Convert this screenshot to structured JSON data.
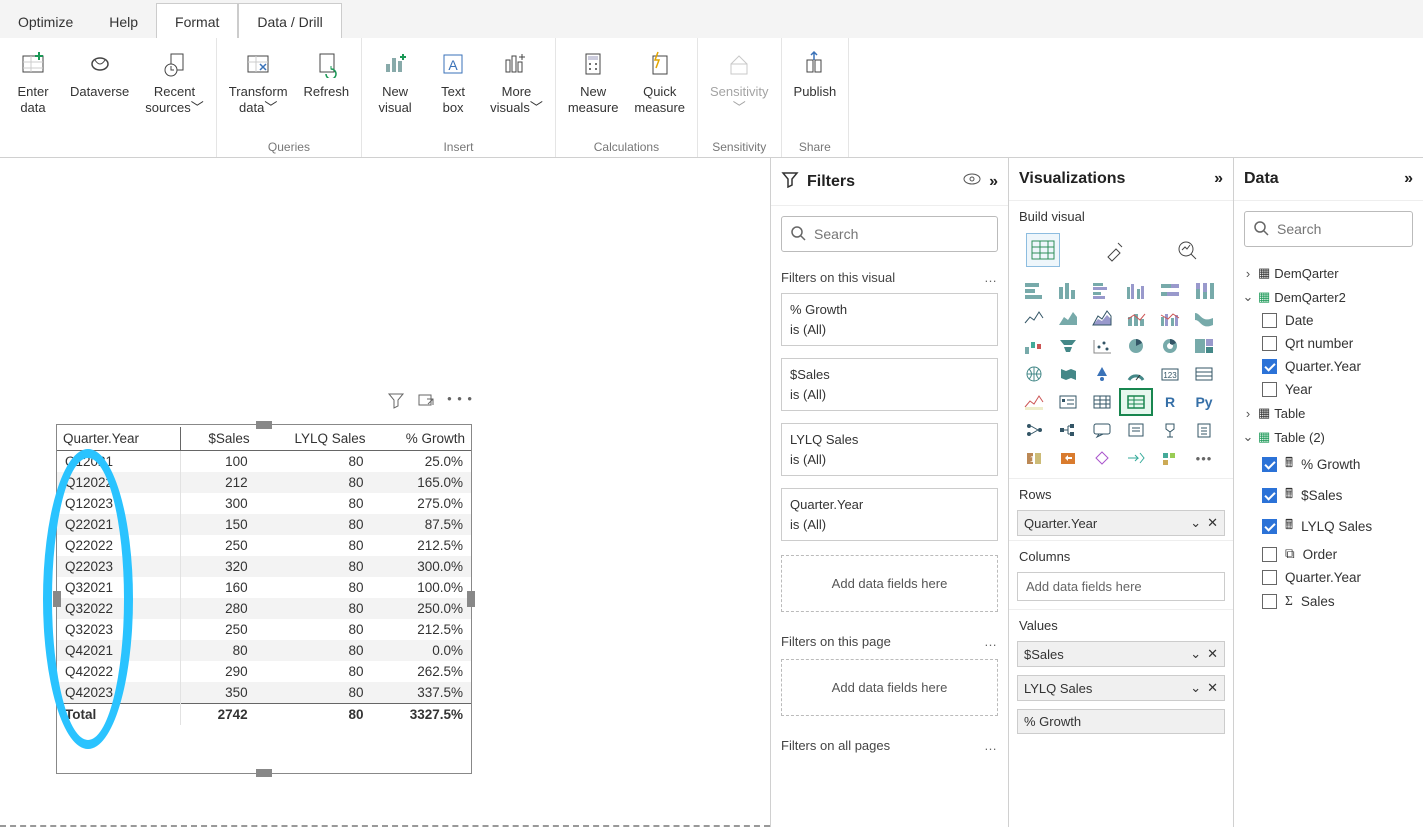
{
  "ribbon_tabs": {
    "t0": "Optimize",
    "t1": "Help",
    "t2": "Format",
    "t3": "Data / Drill"
  },
  "ribbon": {
    "data_group": "",
    "enter_data": "Enter\ndata",
    "dataverse": "Dataverse",
    "recent_sources": "Recent\nsources",
    "queries_group": "Queries",
    "transform_data": "Transform\ndata",
    "refresh": "Refresh",
    "insert_group": "Insert",
    "new_visual": "New\nvisual",
    "text_box": "Text\nbox",
    "more_visuals": "More\nvisuals",
    "calc_group": "Calculations",
    "new_measure": "New\nmeasure",
    "quick_measure": "Quick\nmeasure",
    "sens_group": "Sensitivity",
    "sensitivity": "Sensitivity",
    "share_group": "Share",
    "publish": "Publish"
  },
  "filters": {
    "title": "Filters",
    "search_placeholder": "Search",
    "on_visual": "Filters on this visual",
    "on_page": "Filters on this page",
    "on_all": "Filters on all pages",
    "add_fields": "Add data fields here",
    "is_all": "is (All)",
    "f1": "% Growth",
    "f2": "$Sales",
    "f3": "LYLQ Sales",
    "f4": "Quarter.Year"
  },
  "viz": {
    "title": "Visualizations",
    "build": "Build visual",
    "rows": "Rows",
    "columns": "Columns",
    "values": "Values",
    "chip_rows": "Quarter.Year",
    "chip_v1": "$Sales",
    "chip_v2": "LYLQ Sales",
    "chip_v3": "% Growth",
    "add_fields": "Add data fields here"
  },
  "datapane": {
    "title": "Data",
    "search_placeholder": "Search",
    "g1": "DemQarter",
    "g2": "DemQarter2",
    "g2_f1": "Date",
    "g2_f2": "Qrt number",
    "g2_f3": "Quarter.Year",
    "g2_f4": "Year",
    "g3": "Table",
    "g4": "Table (2)",
    "g4_f1": "% Growth",
    "g4_f2": "$Sales",
    "g4_f3": "LYLQ Sales",
    "g4_f4": "Order",
    "g4_f5": "Quarter.Year",
    "g4_f6": "Sales"
  },
  "table": {
    "headers": {
      "c0": "Quarter.Year",
      "c1": "$Sales",
      "c2": "LYLQ Sales",
      "c3": "% Growth"
    },
    "rows": [
      {
        "c0": "Q12021",
        "c1": "100",
        "c2": "80",
        "c3": "25.0%"
      },
      {
        "c0": "Q12022",
        "c1": "212",
        "c2": "80",
        "c3": "165.0%"
      },
      {
        "c0": "Q12023",
        "c1": "300",
        "c2": "80",
        "c3": "275.0%"
      },
      {
        "c0": "Q22021",
        "c1": "150",
        "c2": "80",
        "c3": "87.5%"
      },
      {
        "c0": "Q22022",
        "c1": "250",
        "c2": "80",
        "c3": "212.5%"
      },
      {
        "c0": "Q22023",
        "c1": "320",
        "c2": "80",
        "c3": "300.0%"
      },
      {
        "c0": "Q32021",
        "c1": "160",
        "c2": "80",
        "c3": "100.0%"
      },
      {
        "c0": "Q32022",
        "c1": "280",
        "c2": "80",
        "c3": "250.0%"
      },
      {
        "c0": "Q32023",
        "c1": "250",
        "c2": "80",
        "c3": "212.5%"
      },
      {
        "c0": "Q42021",
        "c1": "80",
        "c2": "80",
        "c3": "0.0%"
      },
      {
        "c0": "Q42022",
        "c1": "290",
        "c2": "80",
        "c3": "262.5%"
      },
      {
        "c0": "Q42023",
        "c1": "350",
        "c2": "80",
        "c3": "337.5%"
      }
    ],
    "total": {
      "c0": "Total",
      "c1": "2742",
      "c2": "80",
      "c3": "3327.5%"
    }
  }
}
